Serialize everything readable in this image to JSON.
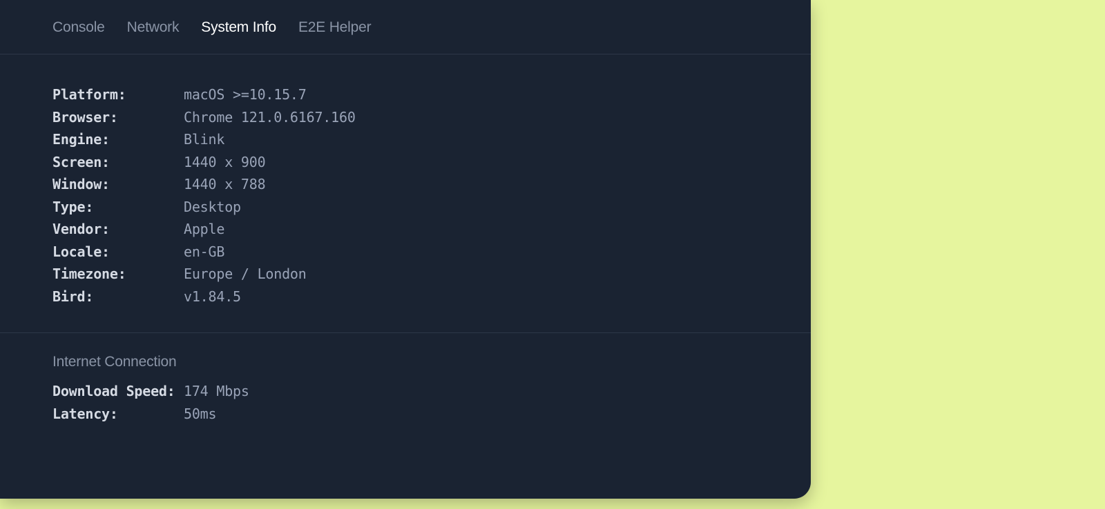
{
  "tabs": {
    "console": "Console",
    "network": "Network",
    "system_info": "System Info",
    "e2e_helper": "E2E Helper"
  },
  "info": {
    "labels": {
      "platform": "Platform:",
      "browser": "Browser:",
      "engine": "Engine:",
      "screen": "Screen:",
      "window": "Window:",
      "type": "Type:",
      "vendor": "Vendor:",
      "locale": "Locale:",
      "timezone": "Timezone:",
      "bird": "Bird:"
    },
    "values": {
      "platform": "macOS >=10.15.7",
      "browser": "Chrome 121.0.6167.160",
      "engine": "Blink",
      "screen": "1440 x 900",
      "window": "1440 x 788",
      "type": "Desktop",
      "vendor": "Apple",
      "locale": "en-GB",
      "timezone": "Europe / London",
      "bird": "v1.84.5"
    }
  },
  "connection": {
    "title": "Internet Connection",
    "labels": {
      "download_speed": "Download Speed:",
      "latency": "Latency:"
    },
    "values": {
      "download_speed": "174 Mbps",
      "latency": "50ms"
    }
  }
}
